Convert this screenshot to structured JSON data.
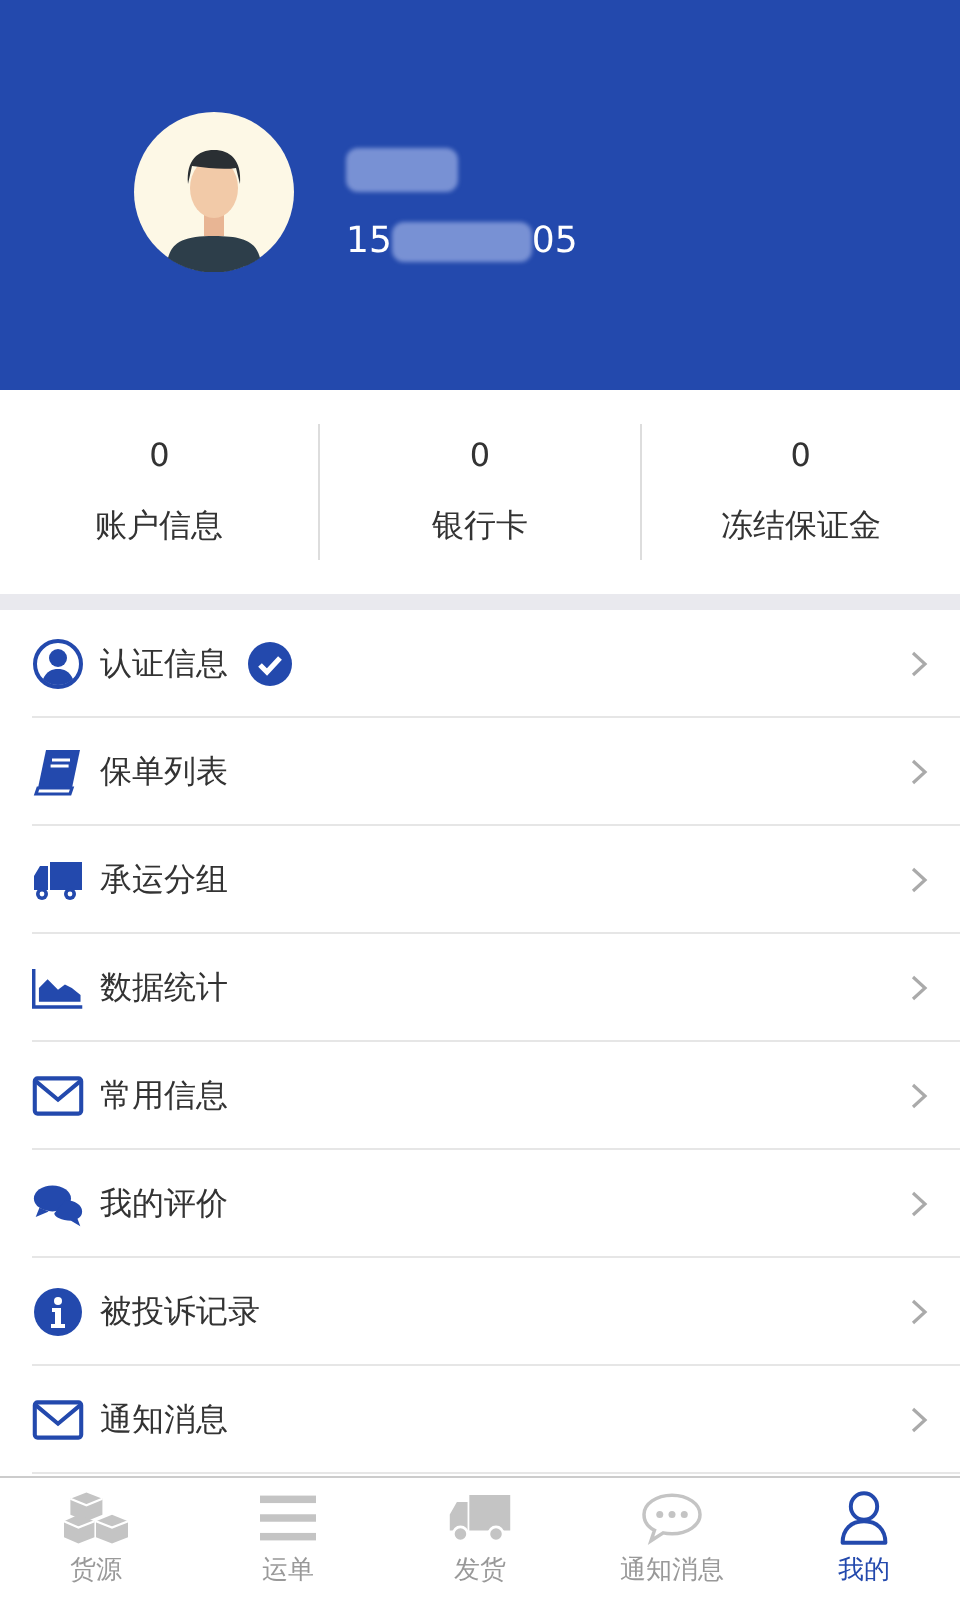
{
  "profile": {
    "phone_start": "15",
    "phone_end": "05"
  },
  "stats": [
    {
      "value": "0",
      "label": "账户信息"
    },
    {
      "value": "0",
      "label": "银行卡"
    },
    {
      "value": "0",
      "label": "冻结保证金"
    }
  ],
  "menu": [
    {
      "label": "认证信息",
      "verified": true
    },
    {
      "label": "保单列表",
      "verified": false
    },
    {
      "label": "承运分组",
      "verified": false
    },
    {
      "label": "数据统计",
      "verified": false
    },
    {
      "label": "常用信息",
      "verified": false
    },
    {
      "label": "我的评价",
      "verified": false
    },
    {
      "label": "被投诉记录",
      "verified": false
    },
    {
      "label": "通知消息",
      "verified": false
    }
  ],
  "tabs": [
    {
      "label": "货源",
      "selected": false
    },
    {
      "label": "运单",
      "selected": false
    },
    {
      "label": "发货",
      "selected": false
    },
    {
      "label": "通知消息",
      "selected": false
    },
    {
      "label": "我的",
      "selected": true
    }
  ]
}
